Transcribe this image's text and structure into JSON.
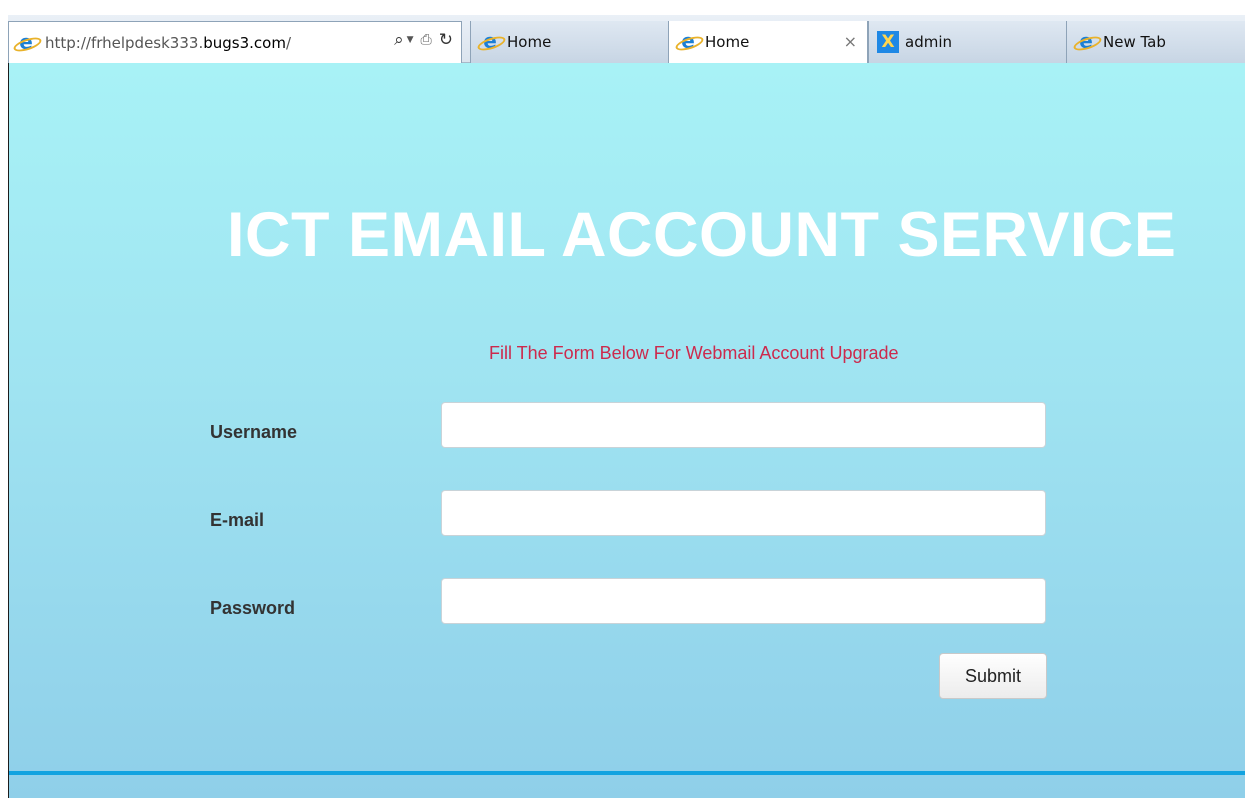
{
  "browser": {
    "address_bar": {
      "url_prefix": "http://frhelpdesk333.",
      "url_domain": "bugs3.com",
      "url_suffix": "/",
      "search_icon": "magnifier-icon",
      "compat_icon": "compatibility-view-icon",
      "refresh_icon": "refresh-icon"
    },
    "tabs": [
      {
        "label": "Home",
        "icon": "ie-icon",
        "active": false
      },
      {
        "label": "Home",
        "icon": "ie-icon",
        "active": true,
        "close": "×"
      },
      {
        "label": "admin",
        "icon": "admin-app-icon",
        "active": false
      },
      {
        "label": "New Tab",
        "icon": "ie-icon",
        "active": false
      }
    ]
  },
  "page": {
    "title": "ICT EMAIL ACCOUNT SERVICE",
    "instruction": "Fill The Form Below For Webmail Account Upgrade",
    "form": {
      "fields": [
        {
          "label": "Username",
          "value": ""
        },
        {
          "label": "E-mail",
          "value": ""
        },
        {
          "label": "Password",
          "value": ""
        }
      ],
      "submit_label": "Submit"
    },
    "colors": {
      "background_top": "#a8f2f6",
      "background_bottom": "#8fcfe9",
      "title": "#ffffff",
      "instruction": "#cc2a4d",
      "footer_line": "#12a3e0"
    }
  }
}
